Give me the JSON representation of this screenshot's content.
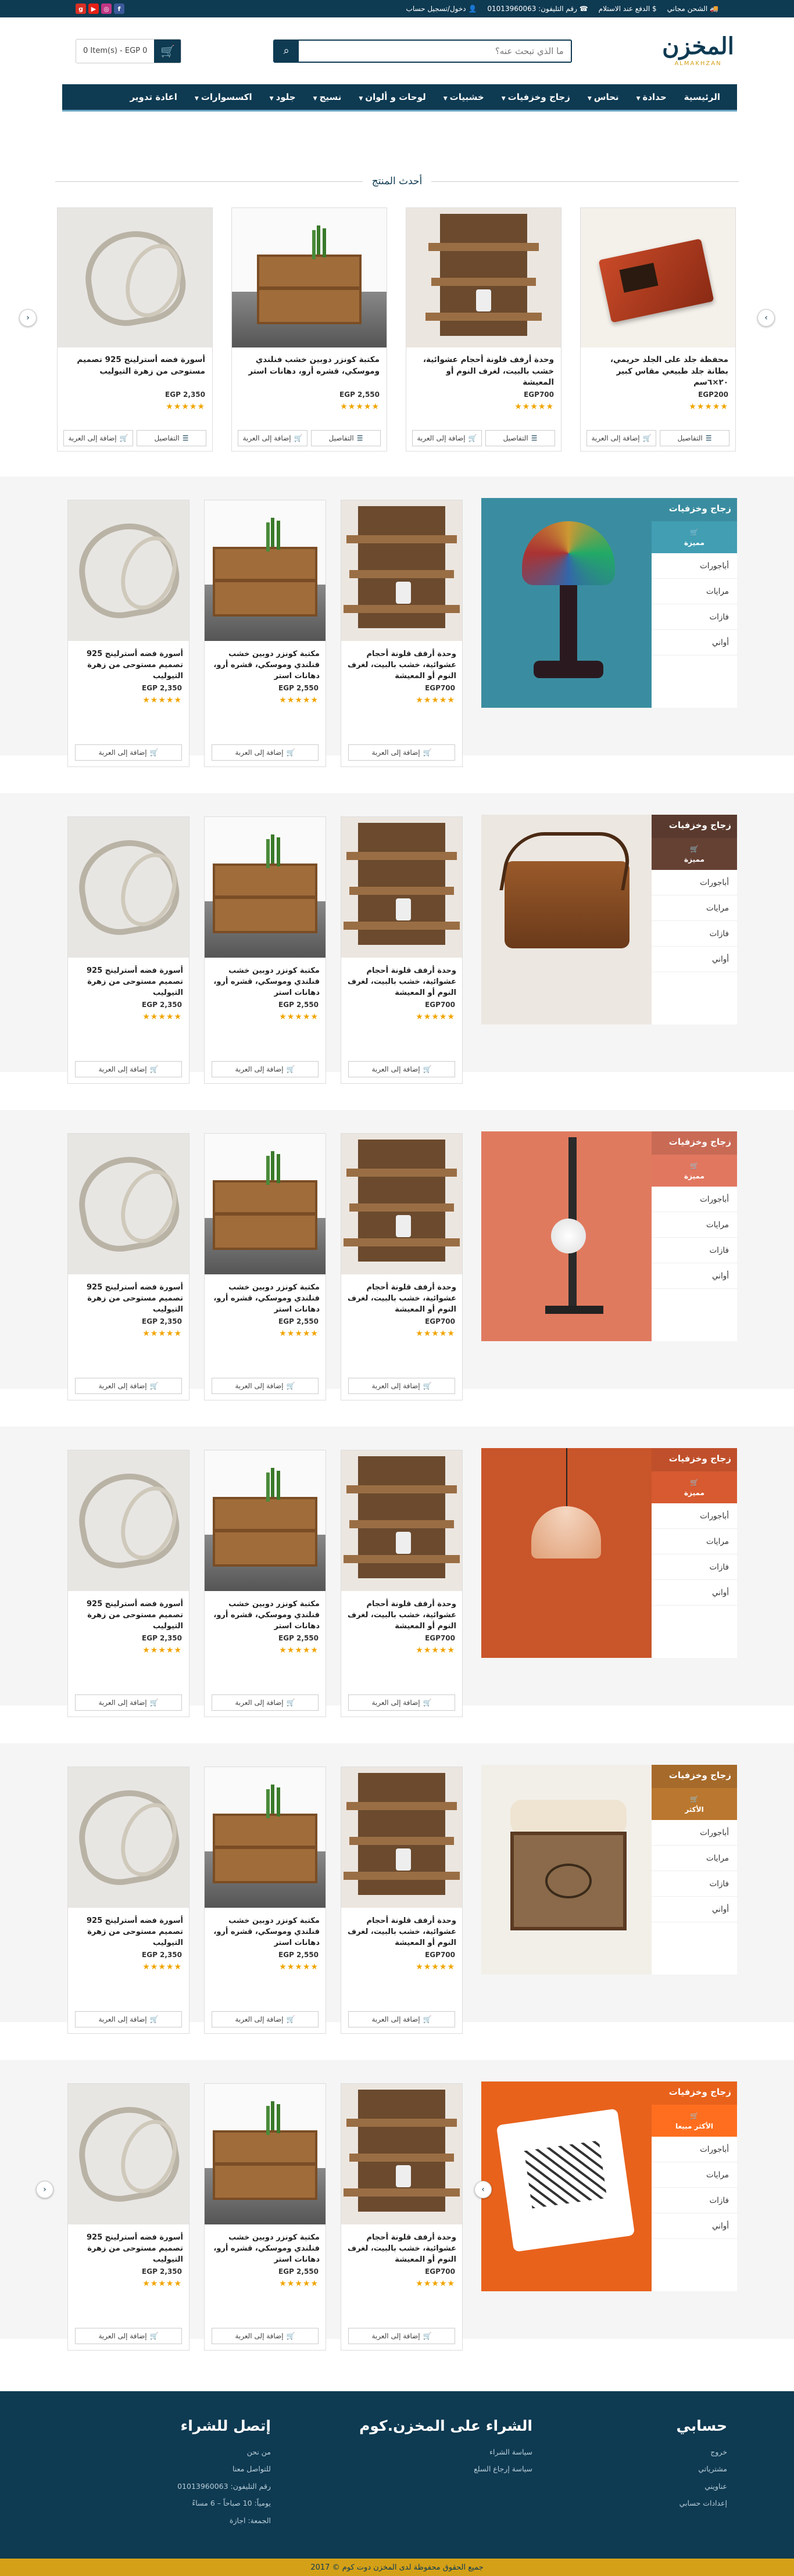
{
  "topbar": {
    "shipping": "الشحن مجاني",
    "payment": "الدفع عند الاستلام",
    "phone": "رقم التليفون: 01013960063",
    "login": "دخول/تسجيل حساب"
  },
  "header": {
    "logo_text": "المخزن",
    "logo_sub": "ALMAKHZAN",
    "search_placeholder": "ما الذي تبحث عنه؟",
    "cart_text": "0 Item(s) - EGP 0"
  },
  "nav": [
    {
      "label": "الرئيسية",
      "dropdown": false
    },
    {
      "label": "حدادة",
      "dropdown": true
    },
    {
      "label": "نحاس",
      "dropdown": true
    },
    {
      "label": "زجاج وخزفيات",
      "dropdown": true
    },
    {
      "label": "خشبيات",
      "dropdown": true
    },
    {
      "label": "لوحات و ألوان",
      "dropdown": true
    },
    {
      "label": "نسيج",
      "dropdown": true
    },
    {
      "label": "جلود",
      "dropdown": true
    },
    {
      "label": "اكسسوارات",
      "dropdown": true
    },
    {
      "label": "اعادة تدوير",
      "dropdown": false
    }
  ],
  "latest_title": "أحدث المنتج",
  "buttons": {
    "details": "التفاصيل",
    "add_to_cart": "إضافة إلى العربة"
  },
  "latest_products": [
    {
      "name": "محفظة جلد على الجلد حريمي، بطانة جلد طبيعي مقاس كبير ٢٠×٦سم",
      "price": "EGP200",
      "stars": "★★★★★"
    },
    {
      "name": "وحدة أرفف قلونة أحجام عشوائية، خشب بالبيت، لغرف النوم أو المعيشة",
      "price": "EGP700",
      "stars": "★★★★★"
    },
    {
      "name": "مكتبة كونزر دوبين خشب فنلندي وموسكي، قشره أرو، دهانات استر",
      "price": "EGP 2,550",
      "stars": "★★★★★"
    },
    {
      "name": "أسورة فضه أسترلينج 925 تصميم مستوحى من زهرة التيوليب",
      "price": "EGP 2,350",
      "stars": "★★★★★"
    }
  ],
  "side_products": [
    {
      "name": "وحدة أرفف قلونة أحجام عشوائية، خشب بالبيت، لغرف النوم أو المعيشة",
      "price": "EGP700",
      "stars": "★★★★★"
    },
    {
      "name": "مكتبة كونزر دوبين خشب فنلندي وموسكي، قشره أرو، دهانات استر",
      "price": "EGP 2,550",
      "stars": "★★★★★"
    },
    {
      "name": "أسورة فضه أسترلينج 925 تصميم مستوحى من زهرة التيوليب",
      "price": "EGP 2,350",
      "stars": "★★★★★"
    }
  ],
  "category_sections": [
    {
      "title": "زجاج وخزفيات",
      "badge": "مميزة",
      "color": "#3a8da0",
      "items": [
        "أباجورات",
        "مرايات",
        "فازات",
        "أواني"
      ]
    },
    {
      "title": "زجاج وخزفيات",
      "badge": "مميزة",
      "color": "#5a3a2e",
      "items": [
        "أباجورات",
        "مرايات",
        "فازات",
        "أواني"
      ]
    },
    {
      "title": "زجاج وخزفيات",
      "badge": "مميزة",
      "color": "#c96a55",
      "items": [
        "أباجورات",
        "مرايات",
        "فازات",
        "أواني"
      ]
    },
    {
      "title": "زجاج وخزفيات",
      "badge": "مميزة",
      "color": "#c0502b",
      "items": [
        "أباجورات",
        "مرايات",
        "فازات",
        "أواني"
      ]
    },
    {
      "title": "زجاج وخزفيات",
      "badge": "الأكثر",
      "color": "#a66a2a",
      "items": [
        "أباجورات",
        "مرايات",
        "فازات",
        "أواني"
      ]
    },
    {
      "title": "زجاج وخزفيات",
      "badge": "الأكثر مبيعا",
      "color": "#e8621c",
      "items": [
        "أباجورات",
        "مرايات",
        "فازات",
        "أواني"
      ]
    }
  ],
  "footer": {
    "account": {
      "title": "حسابي",
      "links": [
        "خروج",
        "مشترياتي",
        "عناويني",
        "إعدادات حسابي"
      ]
    },
    "shop": {
      "title": "الشراء على المخزن.كوم",
      "links": [
        "سياسة الشراء",
        "سياسة إرجاع السلع"
      ]
    },
    "contact": {
      "title": "إتصل للشراء",
      "links": [
        "من نحن",
        "للتواصل معنا",
        "رقم التليفون: 01013960063",
        "يومياً: 10 صباحاً – 6 مساءً",
        "الجمعة: اجازة"
      ]
    }
  },
  "copyright": "جميع الحقوق محفوظة لدى المخزن دوت كوم © 2017",
  "colors": {
    "primary": "#0e3a52",
    "accent": "#d4a017",
    "stars": "#f0a500"
  }
}
